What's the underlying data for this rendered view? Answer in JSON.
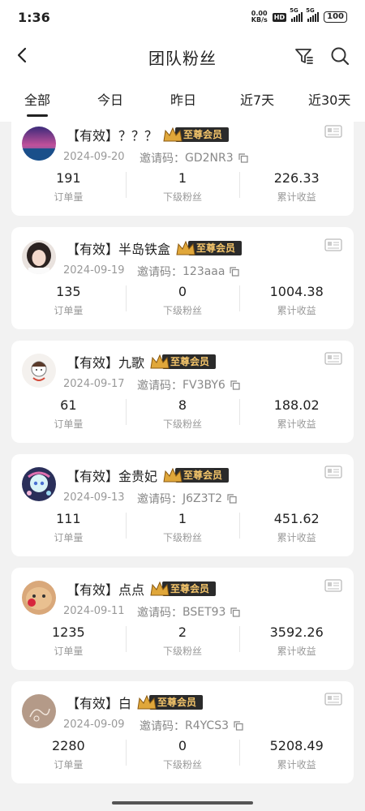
{
  "status": {
    "time": "1:36",
    "net_speed_top": "0.00",
    "net_speed_bottom": "KB/s",
    "hd": "HD",
    "sig1": "5G",
    "sig2": "5G",
    "battery": "100"
  },
  "header": {
    "title": "团队粉丝"
  },
  "tabs": [
    "全部",
    "今日",
    "昨日",
    "近7天",
    "近30天"
  ],
  "labels": {
    "orders": "订单量",
    "subfans": "下级粉丝",
    "earnings": "累计收益",
    "invite_prefix": "邀请码：",
    "badge": "至尊会员"
  },
  "fans": [
    {
      "name": "【有效】？？？",
      "date": "2024-09-20",
      "invite_code": "GD2NR3",
      "orders": "191",
      "subfans": "1",
      "earnings": "226.33"
    },
    {
      "name": "【有效】半岛铁盒",
      "date": "2024-09-19",
      "invite_code": "123aaa",
      "orders": "135",
      "subfans": "0",
      "earnings": "1004.38"
    },
    {
      "name": "【有效】九歌",
      "date": "2024-09-17",
      "invite_code": "FV3BY6",
      "orders": "61",
      "subfans": "8",
      "earnings": "188.02"
    },
    {
      "name": "【有效】金贵妃",
      "date": "2024-09-13",
      "invite_code": "J6Z3T2",
      "orders": "111",
      "subfans": "1",
      "earnings": "451.62"
    },
    {
      "name": "【有效】点点",
      "date": "2024-09-11",
      "invite_code": "BSET93",
      "orders": "1235",
      "subfans": "2",
      "earnings": "3592.26"
    },
    {
      "name": "【有效】白",
      "date": "2024-09-09",
      "invite_code": "R4YCS3",
      "orders": "2280",
      "subfans": "0",
      "earnings": "5208.49"
    }
  ]
}
